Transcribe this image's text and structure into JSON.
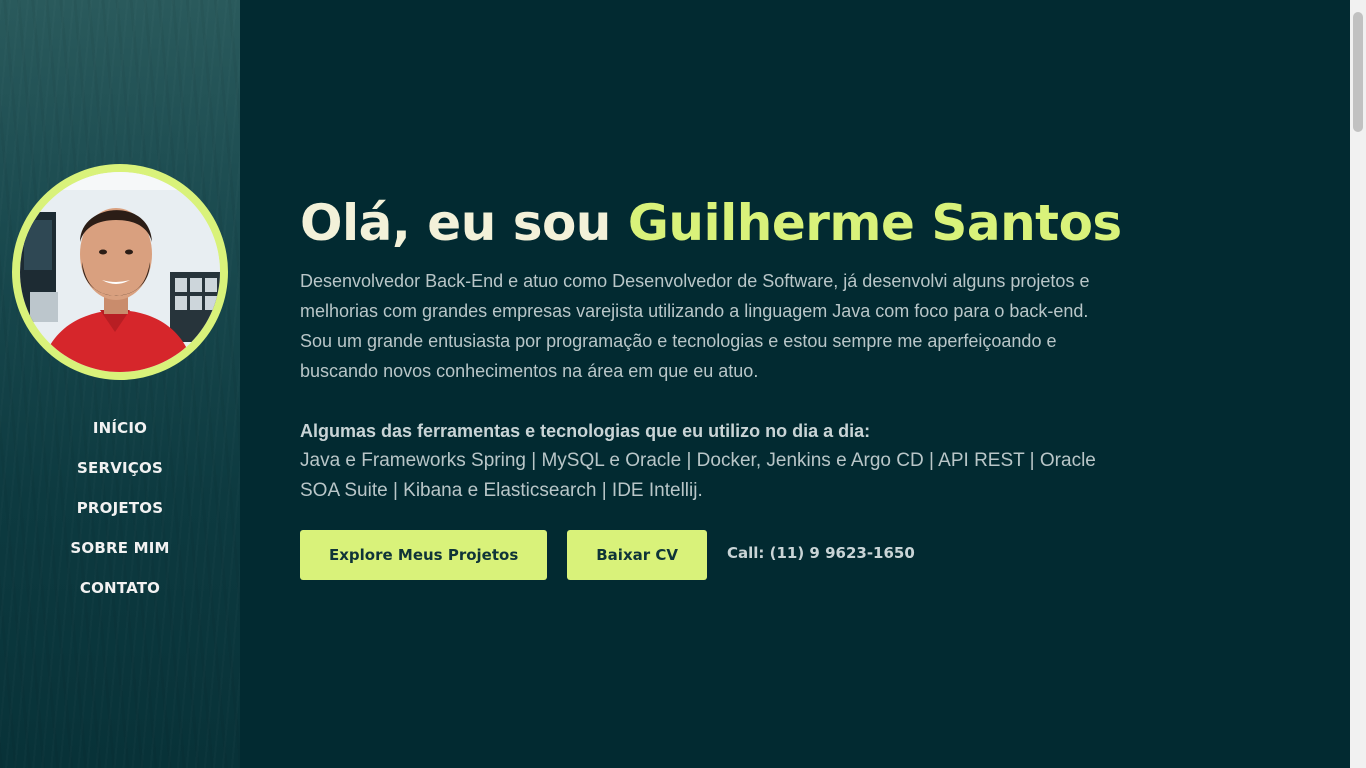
{
  "sidebar": {
    "nav": [
      "INÍCIO",
      "SERVIÇOS",
      "PROJETOS",
      "SOBRE MIM",
      "CONTATO"
    ]
  },
  "hero": {
    "greeting": "Olá, eu sou",
    "name": "Guilherme Santos",
    "intro": "Desenvolvedor Back-End e atuo como Desenvolvedor de Software, já desenvolvi alguns projetos e melhorias com grandes empresas varejista utilizando a linguagem Java com foco para o back-end. Sou um grande entusiasta por programação e tecnologias e estou sempre me aperfeiçoando e buscando novos conhecimentos na área em que eu atuo.",
    "tools_heading": "Algumas das ferramentas e tecnologias que eu utilizo no dia a dia:",
    "tools_list": "Java e Frameworks Spring | MySQL e Oracle | Docker, Jenkins e Argo CD | API REST | Oracle SOA Suite | Kibana e Elasticsearch | IDE Intellij."
  },
  "actions": {
    "projects_button": "Explore Meus Projetos",
    "cv_button": "Baixar CV",
    "call": "Call: (11) 9 9623-1650"
  },
  "colors": {
    "accent": "#d9f27a",
    "background": "#022a31"
  }
}
